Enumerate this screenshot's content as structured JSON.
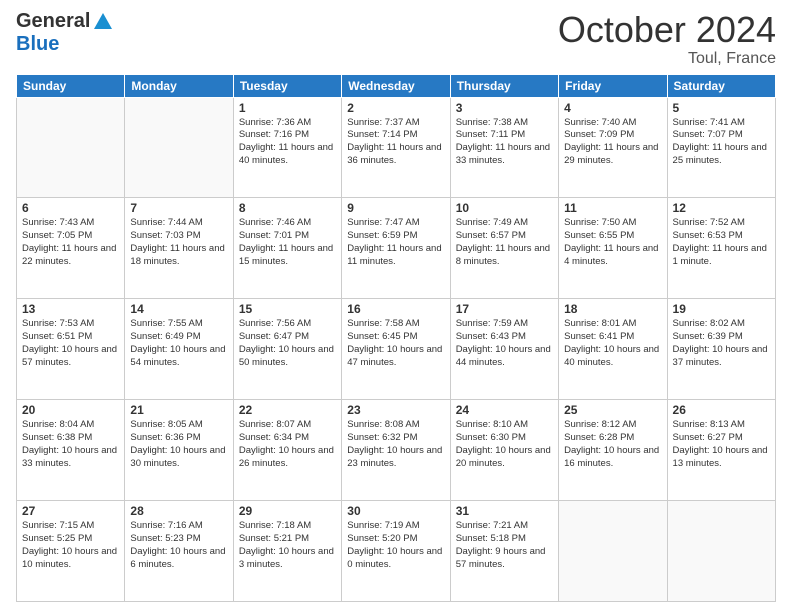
{
  "header": {
    "logo_general": "General",
    "logo_blue": "Blue",
    "month_title": "October 2024",
    "location": "Toul, France"
  },
  "weekdays": [
    "Sunday",
    "Monday",
    "Tuesday",
    "Wednesday",
    "Thursday",
    "Friday",
    "Saturday"
  ],
  "weeks": [
    [
      {
        "day": "",
        "info": ""
      },
      {
        "day": "",
        "info": ""
      },
      {
        "day": "1",
        "info": "Sunrise: 7:36 AM\nSunset: 7:16 PM\nDaylight: 11 hours and 40 minutes."
      },
      {
        "day": "2",
        "info": "Sunrise: 7:37 AM\nSunset: 7:14 PM\nDaylight: 11 hours and 36 minutes."
      },
      {
        "day": "3",
        "info": "Sunrise: 7:38 AM\nSunset: 7:11 PM\nDaylight: 11 hours and 33 minutes."
      },
      {
        "day": "4",
        "info": "Sunrise: 7:40 AM\nSunset: 7:09 PM\nDaylight: 11 hours and 29 minutes."
      },
      {
        "day": "5",
        "info": "Sunrise: 7:41 AM\nSunset: 7:07 PM\nDaylight: 11 hours and 25 minutes."
      }
    ],
    [
      {
        "day": "6",
        "info": "Sunrise: 7:43 AM\nSunset: 7:05 PM\nDaylight: 11 hours and 22 minutes."
      },
      {
        "day": "7",
        "info": "Sunrise: 7:44 AM\nSunset: 7:03 PM\nDaylight: 11 hours and 18 minutes."
      },
      {
        "day": "8",
        "info": "Sunrise: 7:46 AM\nSunset: 7:01 PM\nDaylight: 11 hours and 15 minutes."
      },
      {
        "day": "9",
        "info": "Sunrise: 7:47 AM\nSunset: 6:59 PM\nDaylight: 11 hours and 11 minutes."
      },
      {
        "day": "10",
        "info": "Sunrise: 7:49 AM\nSunset: 6:57 PM\nDaylight: 11 hours and 8 minutes."
      },
      {
        "day": "11",
        "info": "Sunrise: 7:50 AM\nSunset: 6:55 PM\nDaylight: 11 hours and 4 minutes."
      },
      {
        "day": "12",
        "info": "Sunrise: 7:52 AM\nSunset: 6:53 PM\nDaylight: 11 hours and 1 minute."
      }
    ],
    [
      {
        "day": "13",
        "info": "Sunrise: 7:53 AM\nSunset: 6:51 PM\nDaylight: 10 hours and 57 minutes."
      },
      {
        "day": "14",
        "info": "Sunrise: 7:55 AM\nSunset: 6:49 PM\nDaylight: 10 hours and 54 minutes."
      },
      {
        "day": "15",
        "info": "Sunrise: 7:56 AM\nSunset: 6:47 PM\nDaylight: 10 hours and 50 minutes."
      },
      {
        "day": "16",
        "info": "Sunrise: 7:58 AM\nSunset: 6:45 PM\nDaylight: 10 hours and 47 minutes."
      },
      {
        "day": "17",
        "info": "Sunrise: 7:59 AM\nSunset: 6:43 PM\nDaylight: 10 hours and 44 minutes."
      },
      {
        "day": "18",
        "info": "Sunrise: 8:01 AM\nSunset: 6:41 PM\nDaylight: 10 hours and 40 minutes."
      },
      {
        "day": "19",
        "info": "Sunrise: 8:02 AM\nSunset: 6:39 PM\nDaylight: 10 hours and 37 minutes."
      }
    ],
    [
      {
        "day": "20",
        "info": "Sunrise: 8:04 AM\nSunset: 6:38 PM\nDaylight: 10 hours and 33 minutes."
      },
      {
        "day": "21",
        "info": "Sunrise: 8:05 AM\nSunset: 6:36 PM\nDaylight: 10 hours and 30 minutes."
      },
      {
        "day": "22",
        "info": "Sunrise: 8:07 AM\nSunset: 6:34 PM\nDaylight: 10 hours and 26 minutes."
      },
      {
        "day": "23",
        "info": "Sunrise: 8:08 AM\nSunset: 6:32 PM\nDaylight: 10 hours and 23 minutes."
      },
      {
        "day": "24",
        "info": "Sunrise: 8:10 AM\nSunset: 6:30 PM\nDaylight: 10 hours and 20 minutes."
      },
      {
        "day": "25",
        "info": "Sunrise: 8:12 AM\nSunset: 6:28 PM\nDaylight: 10 hours and 16 minutes."
      },
      {
        "day": "26",
        "info": "Sunrise: 8:13 AM\nSunset: 6:27 PM\nDaylight: 10 hours and 13 minutes."
      }
    ],
    [
      {
        "day": "27",
        "info": "Sunrise: 7:15 AM\nSunset: 5:25 PM\nDaylight: 10 hours and 10 minutes."
      },
      {
        "day": "28",
        "info": "Sunrise: 7:16 AM\nSunset: 5:23 PM\nDaylight: 10 hours and 6 minutes."
      },
      {
        "day": "29",
        "info": "Sunrise: 7:18 AM\nSunset: 5:21 PM\nDaylight: 10 hours and 3 minutes."
      },
      {
        "day": "30",
        "info": "Sunrise: 7:19 AM\nSunset: 5:20 PM\nDaylight: 10 hours and 0 minutes."
      },
      {
        "day": "31",
        "info": "Sunrise: 7:21 AM\nSunset: 5:18 PM\nDaylight: 9 hours and 57 minutes."
      },
      {
        "day": "",
        "info": ""
      },
      {
        "day": "",
        "info": ""
      }
    ]
  ]
}
